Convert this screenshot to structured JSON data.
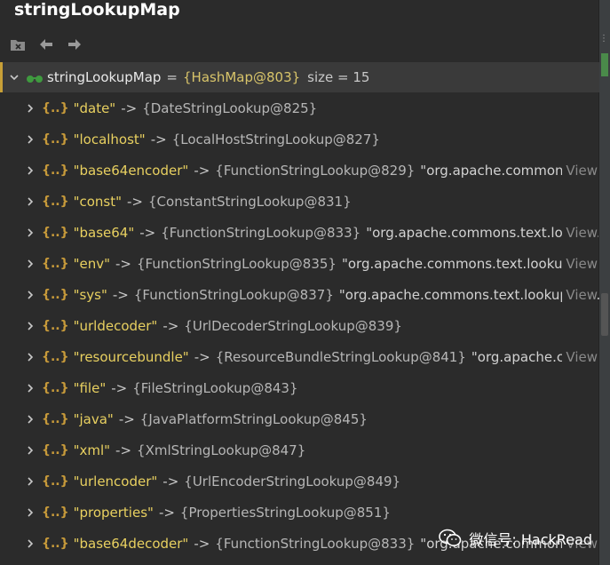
{
  "panel": {
    "title": "stringLookupMap"
  },
  "toolbar": {
    "icons": [
      "delete-watch-icon",
      "back-arrow-icon",
      "forward-arrow-icon"
    ]
  },
  "tree": {
    "root": {
      "name": "stringLookupMap",
      "equals": "=",
      "value": "{HashMap@803}",
      "size": "size = 15"
    },
    "entries": [
      {
        "key": "\"date\"",
        "arrow": "->",
        "value": "{DateStringLookup@825}",
        "extra": "",
        "view": ""
      },
      {
        "key": "\"localhost\"",
        "arrow": "->",
        "value": "{LocalHostStringLookup@827}",
        "extra": "",
        "view": ""
      },
      {
        "key": "\"base64encoder\"",
        "arrow": "->",
        "value": "{FunctionStringLookup@829}",
        "extra": "\"org.apache.commons.te",
        "view": "View"
      },
      {
        "key": "\"const\"",
        "arrow": "->",
        "value": "{ConstantStringLookup@831}",
        "extra": "",
        "view": ""
      },
      {
        "key": "\"base64\"",
        "arrow": "->",
        "value": "{FunctionStringLookup@833}",
        "extra": "\"org.apache.commons.text.looku...",
        "view": "View"
      },
      {
        "key": "\"env\"",
        "arrow": "->",
        "value": "{FunctionStringLookup@835}",
        "extra": "\"org.apache.commons.text.lookup.F...",
        "view": "View"
      },
      {
        "key": "\"sys\"",
        "arrow": "->",
        "value": "{FunctionStringLookup@837}",
        "extra": "\"org.apache.commons.text.lookup.Fu...",
        "view": "View"
      },
      {
        "key": "\"urldecoder\"",
        "arrow": "->",
        "value": "{UrlDecoderStringLookup@839}",
        "extra": "",
        "view": ""
      },
      {
        "key": "\"resourcebundle\"",
        "arrow": "->",
        "value": "{ResourceBundleStringLookup@841}",
        "extra": "\"org.apache.com...",
        "view": "View"
      },
      {
        "key": "\"file\"",
        "arrow": "->",
        "value": "{FileStringLookup@843}",
        "extra": "",
        "view": ""
      },
      {
        "key": "\"java\"",
        "arrow": "->",
        "value": "{JavaPlatformStringLookup@845}",
        "extra": "",
        "view": ""
      },
      {
        "key": "\"xml\"",
        "arrow": "->",
        "value": "{XmlStringLookup@847}",
        "extra": "",
        "view": ""
      },
      {
        "key": "\"urlencoder\"",
        "arrow": "->",
        "value": "{UrlEncoderStringLookup@849}",
        "extra": "",
        "view": ""
      },
      {
        "key": "\"properties\"",
        "arrow": "->",
        "value": "{PropertiesStringLookup@851}",
        "extra": "",
        "view": ""
      },
      {
        "key": "\"base64decoder\"",
        "arrow": "->",
        "value": "{FunctionStringLookup@833}",
        "extra": "\"org.apache.commons.t...",
        "view": "View"
      }
    ]
  },
  "watermark": {
    "text": "微信号: HackRead"
  },
  "colors": {
    "background": "#2b2b2b",
    "key": "#e8d060",
    "brace": "#c79a3a",
    "root_value": "#d8c46a",
    "selection_border": "#c8a037",
    "view_link": "#8a8a8a"
  }
}
